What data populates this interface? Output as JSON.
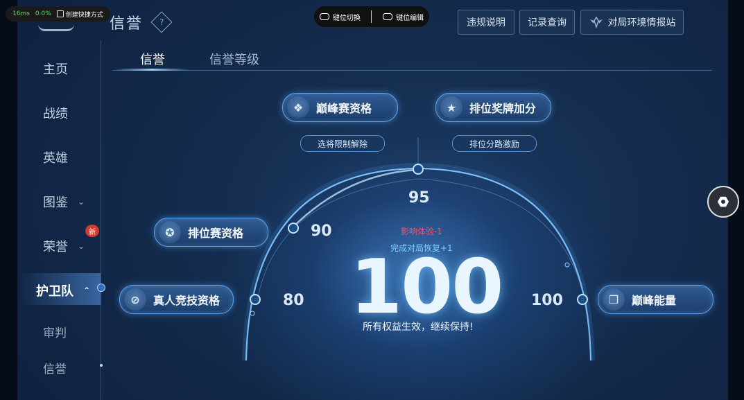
{
  "overlay": {
    "latency": "16ms",
    "percent": "0.0%",
    "shortcut_label": "创建快捷方式",
    "keymap_switch": "键位切换",
    "keymap_edit": "键位编辑"
  },
  "header": {
    "title": "信誉",
    "help_glyph": "?",
    "buttons": [
      "违规说明",
      "记录查询",
      "对局环境情报站"
    ]
  },
  "sidebar": {
    "items": [
      {
        "label": "主页"
      },
      {
        "label": "战绩"
      },
      {
        "label": "英雄"
      },
      {
        "label": "图鉴"
      },
      {
        "label": "荣誉"
      },
      {
        "label": "护卫队"
      },
      {
        "label": "审判"
      },
      {
        "label": "信誉"
      }
    ],
    "new_badge": "新"
  },
  "tabs": [
    "信誉",
    "信誉等级"
  ],
  "privileges": {
    "peak_qualification": "巅峰赛资格",
    "rank_medal_bonus": "排位奖牌加分",
    "pick_restriction_lift": "选将限制解除",
    "rank_lane_incentive": "排位分路激励",
    "ranked_qualification": "排位赛资格",
    "human_match_qualification": "真人竞技资格",
    "peak_energy": "巅峰能量"
  },
  "thresholds": {
    "t80": "80",
    "t90": "90",
    "t95": "95",
    "t100": "100"
  },
  "score": {
    "value": "100",
    "impact": "影响体验-1",
    "recover": "完成对局恢复+1",
    "status": "所有权益生效，继续保持!"
  },
  "icons": {
    "peak": "diamond-cluster-icon",
    "medal": "star-medal-icon",
    "ranked": "shield-star-icon",
    "human": "no-robot-icon",
    "energy": "cube-icon",
    "gamepad": "gamepad-icon",
    "float": "hex-nut-icon"
  },
  "colors": {
    "accent": "#5fa3e8",
    "impact": "#e3577a",
    "recover": "#7fd0ff",
    "new_badge": "#d43a2f"
  }
}
